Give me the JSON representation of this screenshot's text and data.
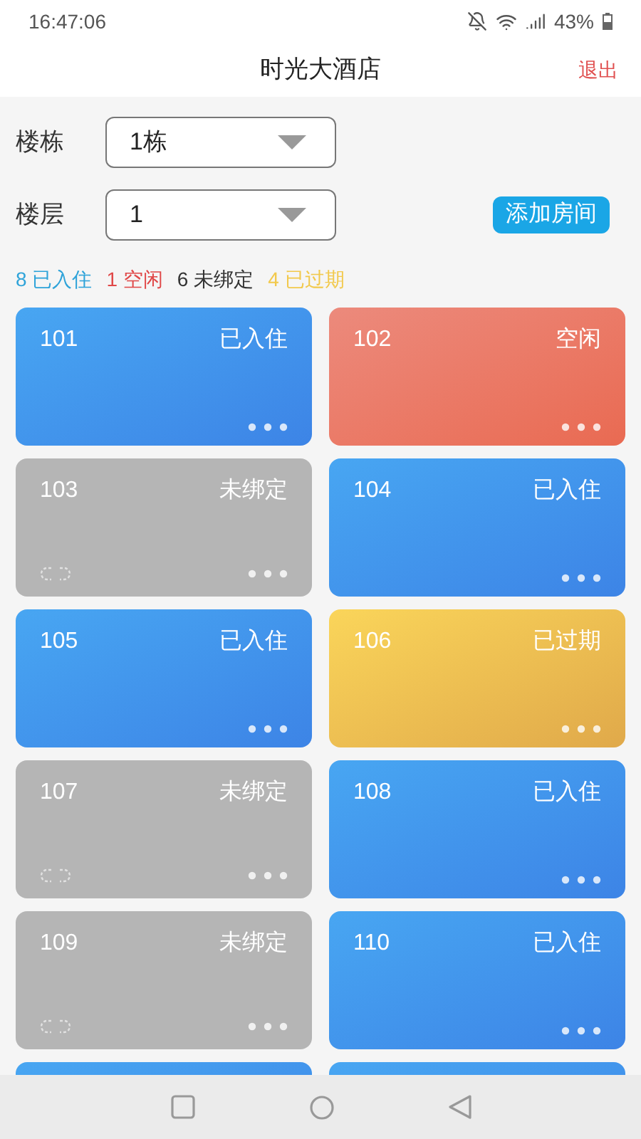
{
  "status_bar": {
    "time": "16:47:06",
    "battery": "43%"
  },
  "header": {
    "title": "时光大酒店",
    "logout": "退出"
  },
  "filters": [
    {
      "label": "楼栋",
      "value": "1栋"
    },
    {
      "label": "楼层",
      "value": "1"
    }
  ],
  "add_button": "添加房间",
  "legend": [
    {
      "count": "8",
      "label": "已入住",
      "color": "#2ea3d9"
    },
    {
      "count": "1",
      "label": "空闲",
      "color": "#e04848"
    },
    {
      "count": "6",
      "label": "未绑定",
      "color": "#333333"
    },
    {
      "count": "4",
      "label": "已过期",
      "color": "#f2c94c"
    }
  ],
  "rooms": [
    {
      "number": "101",
      "status": "已入住",
      "kind": "occupied"
    },
    {
      "number": "102",
      "status": "空闲",
      "kind": "vacant"
    },
    {
      "number": "103",
      "status": "未绑定",
      "kind": "unbound"
    },
    {
      "number": "104",
      "status": "已入住",
      "kind": "occupied"
    },
    {
      "number": "105",
      "status": "已入住",
      "kind": "occupied"
    },
    {
      "number": "106",
      "status": "已过期",
      "kind": "expired"
    },
    {
      "number": "107",
      "status": "未绑定",
      "kind": "unbound"
    },
    {
      "number": "108",
      "status": "已入住",
      "kind": "occupied"
    },
    {
      "number": "109",
      "status": "未绑定",
      "kind": "unbound"
    },
    {
      "number": "110",
      "status": "已入住",
      "kind": "occupied"
    },
    {
      "kind": "occupied"
    },
    {
      "kind": "occupied"
    }
  ]
}
